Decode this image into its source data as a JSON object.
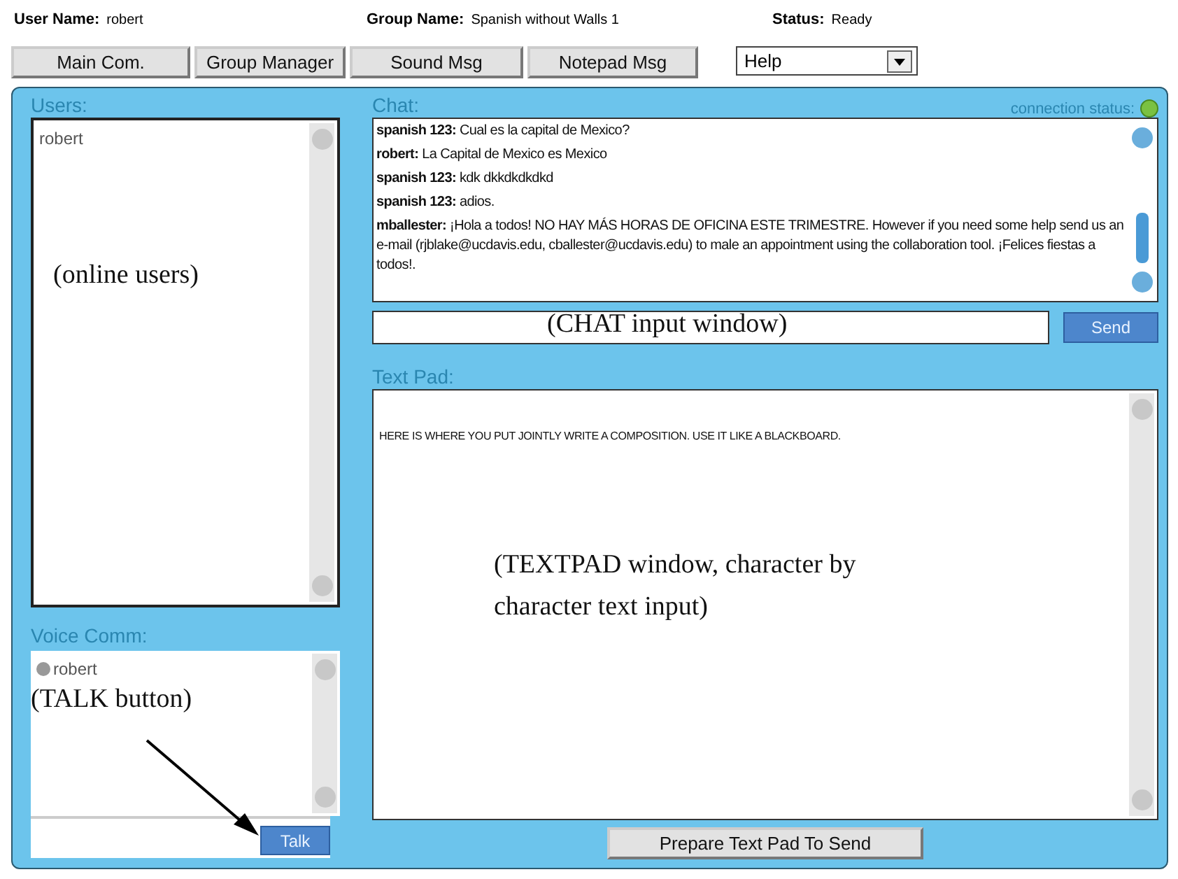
{
  "header": {
    "user_label": "User Name:",
    "user_value": "robert",
    "group_label": "Group Name:",
    "group_value": "Spanish without Walls 1",
    "status_label": "Status:",
    "status_value": "Ready"
  },
  "tabs": [
    {
      "label": "Main Com.",
      "selected": false
    },
    {
      "label": "Group Manager",
      "selected": false
    },
    {
      "label": "Sound Msg",
      "selected": false
    },
    {
      "label": "Notepad Msg",
      "selected": false
    }
  ],
  "help_dropdown": {
    "value": "Help"
  },
  "users": {
    "title": "Users:",
    "items": [
      "robert"
    ],
    "annotation": "(online users)"
  },
  "voice": {
    "title": "Voice Comm:",
    "items": [
      "robert"
    ],
    "annotation": "(TALK button)",
    "button": "Talk"
  },
  "chat": {
    "title": "Chat:",
    "connection_label": "connection status:",
    "messages": [
      {
        "sender": "spanish 123:",
        "text": "Cual es la capital de Mexico?"
      },
      {
        "sender": "robert:",
        "text": "La Capital de Mexico es Mexico"
      },
      {
        "sender": "spanish 123:",
        "text": "kdk dkkdkdkdkd"
      },
      {
        "sender": "spanish 123:",
        "text": "adios."
      },
      {
        "sender": "mballester:",
        "text": "¡Hola a todos! NO HAY MÁS HORAS DE OFICINA ESTE TRIMESTRE. However if you need some help send us an e-mail (rjblake@ucdavis.edu, cballester@ucdavis.edu) to male an appointment using the collaboration tool. ¡Felices fiestas a todos!."
      }
    ],
    "input_annotation": "(CHAT input window)",
    "send_button": "Send"
  },
  "text_pad": {
    "title": "Text Pad:",
    "content": "HERE IS WHERE YOU PUT JOINTLY WRITE A COMPOSITION.  USE IT LIKE A BLACKBOARD.",
    "annotation": "(TEXTPAD window, character by character text input)",
    "button": "Prepare Text Pad To Send"
  }
}
